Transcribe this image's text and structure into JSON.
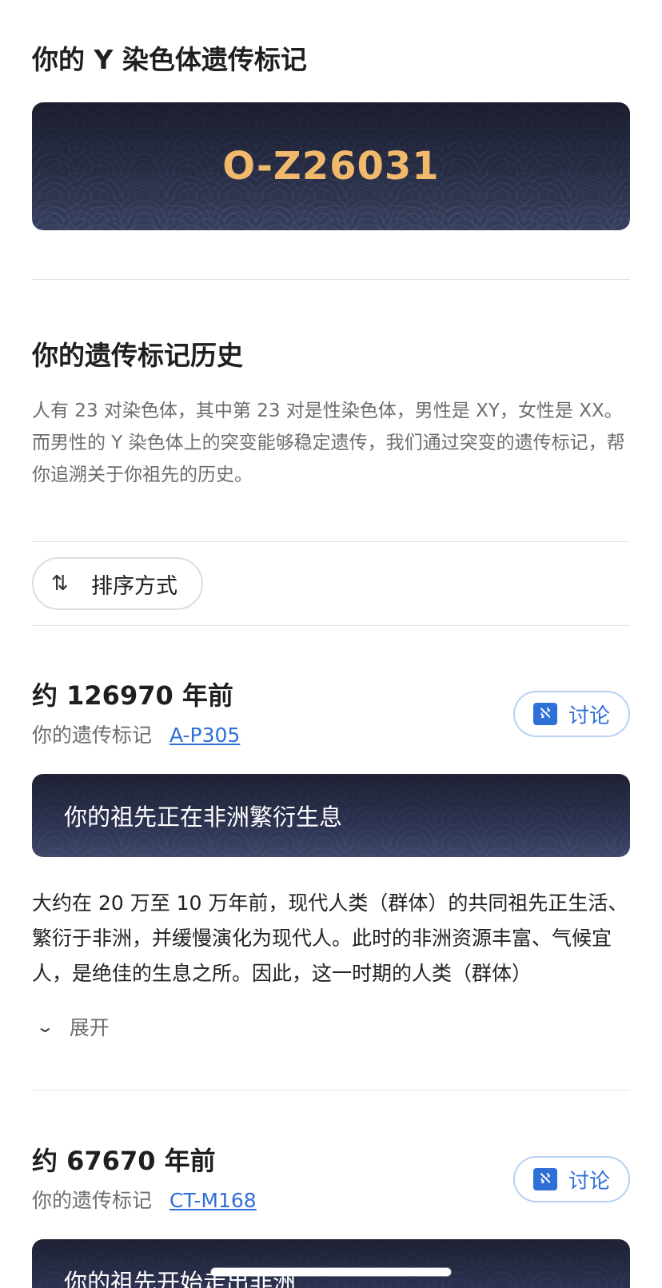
{
  "haplogroup_section": {
    "title": "你的 Y 染色体遗传标记",
    "haplogroup": "O-Z26031"
  },
  "history_section": {
    "title": "你的遗传标记历史",
    "intro": "人有 23 对染色体，其中第 23 对是性染色体，男性是 XY，女性是 XX。而男性的 Y 染色体上的突变能够稳定遗传，我们通过突变的遗传标记，帮你追溯关于你祖先的历史。"
  },
  "sort": {
    "icon": "sort-icon",
    "label": "排序方式"
  },
  "entries": [
    {
      "time": "约 126970 年前",
      "marker_label": "你的遗传标记",
      "marker_link": "A-P305",
      "discuss_label": "讨论",
      "event_title": "你的祖先正在非洲繁衍生息",
      "description": "大约在 20 万至 10 万年前，现代人类（群体）的共同祖先正生活、繁衍于非洲，并缓慢演化为现代人。此时的非洲资源丰富、气候宜人，是绝佳的生息之所。因此，这一时期的人类（群体）",
      "expand_label": "展开"
    },
    {
      "time": "约 67670 年前",
      "marker_label": "你的遗传标记",
      "marker_link": "CT-M168",
      "discuss_label": "讨论",
      "event_title": "你的祖先开始走出非洲"
    }
  ],
  "colors": {
    "accent_gold": "#f0b96b",
    "link_blue": "#2f6fd8",
    "card_navy": "#272b40"
  }
}
